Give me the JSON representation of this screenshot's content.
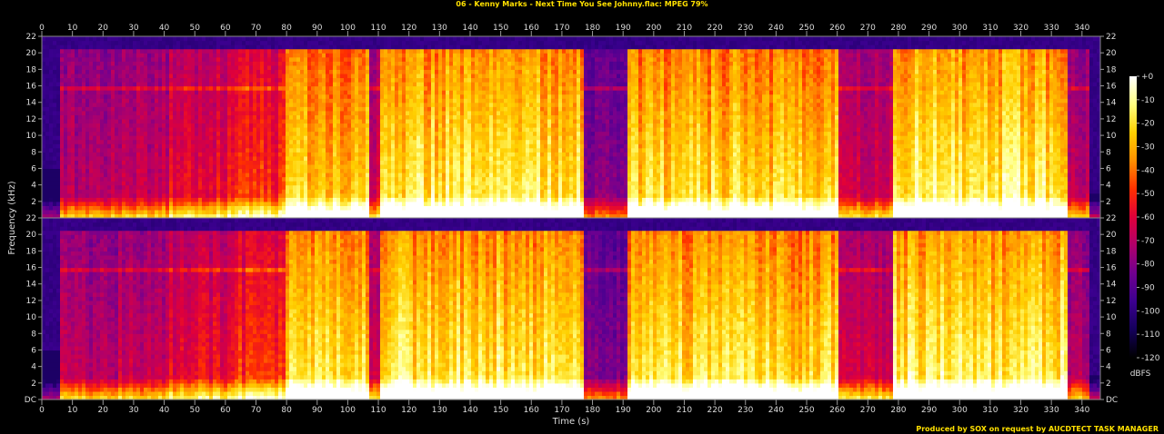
{
  "title": "06 - Kenny Marks - Next Time You See Johnny.flac: MPEG 79%",
  "footer": "Produced by SOX on request by AUCDTECT TASK MANAGER",
  "chart_data": {
    "type": "heatmap",
    "title": "06 - Kenny Marks - Next Time You See Johnny.flac: MPEG 79%",
    "xlabel": "Time (s)",
    "ylabel": "Frequency (kHz)",
    "xlim": [
      0,
      346
    ],
    "ylim": [
      0,
      22
    ],
    "x_ticks": [
      "0",
      "10",
      "20",
      "30",
      "40",
      "50",
      "60",
      "70",
      "80",
      "90",
      "100",
      "110",
      "120",
      "130",
      "140",
      "150",
      "160",
      "170",
      "180",
      "190",
      "200",
      "210",
      "220",
      "230",
      "240",
      "250",
      "260",
      "270",
      "280",
      "290",
      "300",
      "310",
      "320",
      "330",
      "340"
    ],
    "y_ticks": [
      "DC",
      "2",
      "4",
      "6",
      "8",
      "10",
      "12",
      "14",
      "16",
      "18",
      "20",
      "22"
    ],
    "channels": [
      "top",
      "bottom"
    ],
    "colorbar": {
      "label": "dBFS",
      "ticks": [
        "+0",
        "-10",
        "-20",
        "-30",
        "-40",
        "-50",
        "-60",
        "-70",
        "-80",
        "-90",
        "-100",
        "-110",
        "-120"
      ],
      "range": [
        -120,
        0
      ]
    },
    "segments": [
      {
        "start": 0,
        "end": 5,
        "level": 0.05,
        "cutoff": 6
      },
      {
        "start": 5,
        "end": 24,
        "level": 0.45,
        "cutoff": 20.5
      },
      {
        "start": 24,
        "end": 41,
        "level": 0.48,
        "cutoff": 20.5
      },
      {
        "start": 41,
        "end": 60,
        "level": 0.55,
        "cutoff": 20.5
      },
      {
        "start": 60,
        "end": 79,
        "level": 0.62,
        "cutoff": 20.5
      },
      {
        "start": 79,
        "end": 106,
        "level": 0.86,
        "cutoff": 20.5
      },
      {
        "start": 106,
        "end": 110,
        "level": 0.5,
        "cutoff": 20.5
      },
      {
        "start": 110,
        "end": 177,
        "level": 0.9,
        "cutoff": 20.5
      },
      {
        "start": 177,
        "end": 191,
        "level": 0.35,
        "cutoff": 20.5
      },
      {
        "start": 191,
        "end": 260,
        "level": 0.87,
        "cutoff": 20.5
      },
      {
        "start": 260,
        "end": 278,
        "level": 0.5,
        "cutoff": 20.5
      },
      {
        "start": 278,
        "end": 335,
        "level": 0.92,
        "cutoff": 20.5
      },
      {
        "start": 335,
        "end": 342,
        "level": 0.45,
        "cutoff": 20.5
      },
      {
        "start": 342,
        "end": 346,
        "level": 0.08,
        "cutoff": 3
      }
    ],
    "tone_line_khz": 15.5
  }
}
